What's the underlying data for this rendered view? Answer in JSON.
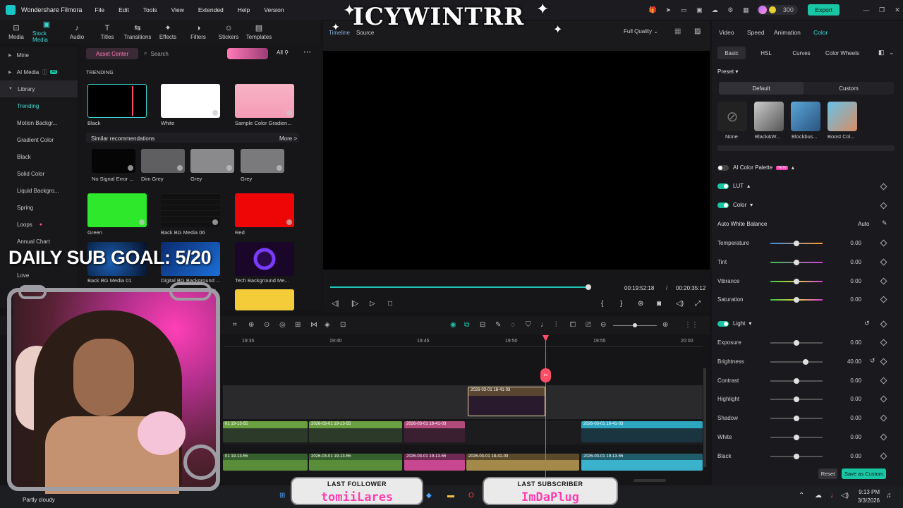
{
  "titlebar": {
    "app_name": "Wondershare Filmora",
    "menu": [
      "File",
      "Edit",
      "Tools",
      "View",
      "Extended",
      "Help",
      "Version"
    ],
    "credits": "300",
    "export_label": "Export"
  },
  "toolbar": {
    "items": [
      {
        "label": "Media",
        "icon": "media-icon"
      },
      {
        "label": "Stock Media",
        "icon": "stock-media-icon"
      },
      {
        "label": "Audio",
        "icon": "audio-icon"
      },
      {
        "label": "Titles",
        "icon": "titles-icon"
      },
      {
        "label": "Transitions",
        "icon": "transitions-icon"
      },
      {
        "label": "Effects",
        "icon": "effects-icon"
      },
      {
        "label": "Filters",
        "icon": "filters-icon"
      },
      {
        "label": "Stickers",
        "icon": "stickers-icon"
      },
      {
        "label": "Templates",
        "icon": "templates-icon"
      }
    ]
  },
  "leftnav": {
    "items": [
      "Mine",
      "AI Media",
      "Library",
      "Trending",
      "Motion Backgr...",
      "Gradient Color",
      "Black",
      "Solid Color",
      "Liquid Backgro...",
      "Spring",
      "Loops",
      "Annual Chart",
      "Love"
    ],
    "ai_badge": "AI"
  },
  "media": {
    "asset_center": "Asset Center",
    "search_placeholder": "Search",
    "filter": "All",
    "trending_heading": "TRENDING",
    "trending": [
      "Black",
      "White",
      "Sample Color Gradien..."
    ],
    "similar_heading": "Similar recommendations",
    "more_label": "More >",
    "similar": [
      "No Signal Error ...",
      "Dim Grey",
      "Grey",
      "Grey"
    ],
    "row3": [
      "Green",
      "Back BG Media 06",
      "Red"
    ],
    "row4": [
      "Back BG Media 01",
      "Digital BG Background ...",
      "Tech Background Me..."
    ]
  },
  "preview": {
    "tab_timeline": "Timeline",
    "tab_source": "Source",
    "quality": "Full Quality",
    "current_time": "00:19:52:18",
    "separator": "/",
    "total_time": "00:20:35:12",
    "progress": 0.99
  },
  "rightpanel": {
    "tabs": [
      "Video",
      "Speed",
      "Animation",
      "Color"
    ],
    "subtabs": [
      "Basic",
      "HSL",
      "Curves",
      "Color Wheels"
    ],
    "preset_heading": "Preset",
    "preset_modes": [
      "Default",
      "Custom"
    ],
    "presets": [
      "None",
      "Black&W...",
      "Blockbus...",
      "Boost Col..."
    ],
    "ai_palette": "AI Color Palette",
    "new_badge": "NEW",
    "lut": "LUT",
    "color": "Color",
    "awb": "Auto White Balance",
    "auto": "Auto",
    "light": "Light",
    "color_sliders": [
      {
        "label": "Temperature",
        "value": "0.00",
        "pos": 0.5
      },
      {
        "label": "Tint",
        "value": "0.00",
        "pos": 0.5
      },
      {
        "label": "Vibrance",
        "value": "0.00",
        "pos": 0.5
      },
      {
        "label": "Saturation",
        "value": "0.00",
        "pos": 0.5
      }
    ],
    "light_sliders": [
      {
        "label": "Exposure",
        "value": "0.00",
        "pos": 0.5
      },
      {
        "label": "Brightness",
        "value": "40.00",
        "pos": 0.68
      },
      {
        "label": "Contrast",
        "value": "0.00",
        "pos": 0.5
      },
      {
        "label": "Highlight",
        "value": "0.00",
        "pos": 0.5
      },
      {
        "label": "Shadow",
        "value": "0.00",
        "pos": 0.5
      },
      {
        "label": "White",
        "value": "0.00",
        "pos": 0.5
      },
      {
        "label": "Black",
        "value": "0.00",
        "pos": 0.5
      }
    ],
    "reset": "Reset",
    "save_custom": "Save as Custom"
  },
  "timeline": {
    "ruler": [
      "19:35",
      "19:40",
      "19:45",
      "19:50",
      "19:55",
      "20:00"
    ],
    "clip_top": "2026-03-01 18-41-03",
    "clips_video": [
      "01 19-13-55",
      "2026-03-01 19-13-55",
      "2026-03-01 18-41-03",
      "2026-03-01 18-41-03"
    ],
    "clips_audio": [
      "01 19-13-55",
      "2026-03-01 19-13-55",
      "2026-03-01 19-13-55",
      "2026-03-01 18-41-03",
      "2026-03-01 19-13-55"
    ]
  },
  "overlays": {
    "goal": "DAILY SUB GOAL: 5/20",
    "title": "ICYWINTRR",
    "last_follower_h": "LAST FOLLOWER",
    "last_follower": "tomiiLares",
    "last_sub_h": "LAST SUBSCRIBER",
    "last_sub": "ImDaPlug"
  },
  "taskbar": {
    "weather": "Partly cloudy",
    "time": "9:13 PM",
    "date": "3/3/2026"
  },
  "colors": {
    "accent": "#19c6a4",
    "playhead": "#ff4f67",
    "brand_pink": "#ff3cae"
  }
}
